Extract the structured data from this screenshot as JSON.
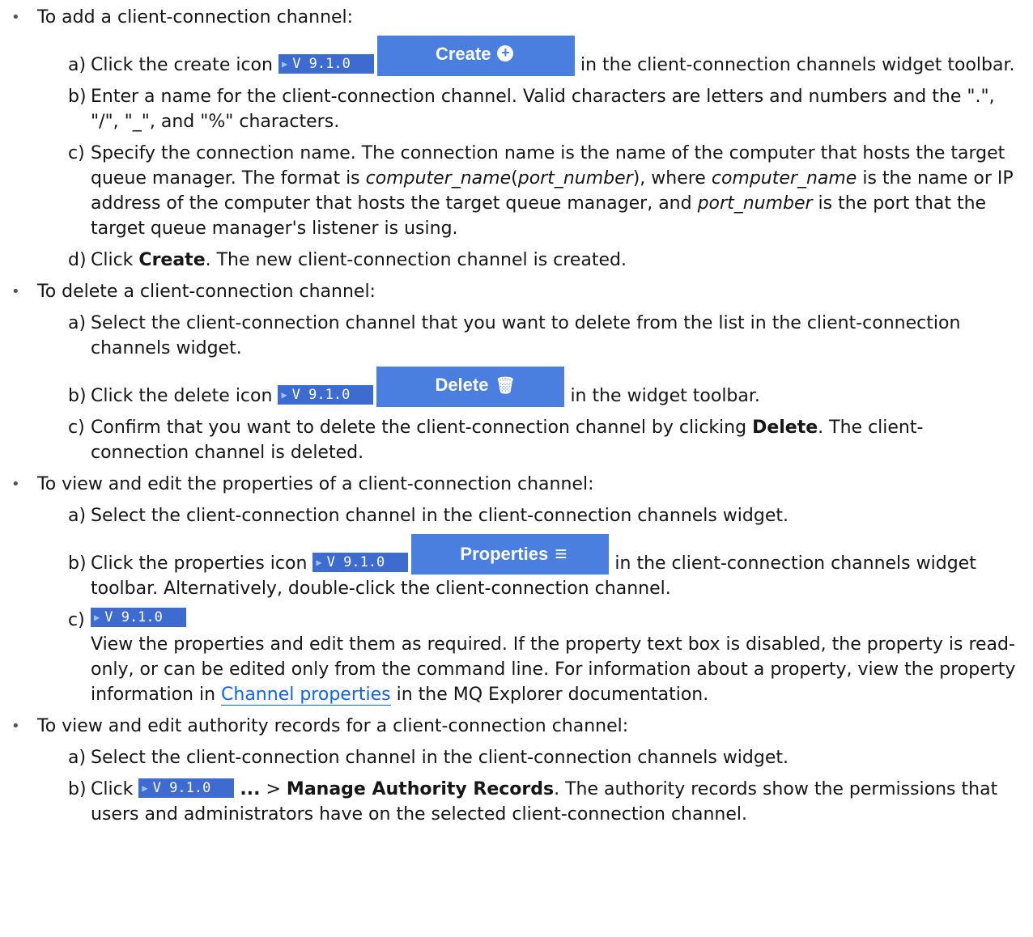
{
  "badge_text": "V 9.1.0",
  "buttons": {
    "create": "Create",
    "delete": "Delete",
    "properties": "Properties"
  },
  "sections": {
    "add": {
      "title": "To add a client-connection channel:",
      "a_label": "a)",
      "a_before": "Click the create icon",
      "a_after": "in the client-connection channels widget toolbar.",
      "b_label": "b)",
      "b_text": "Enter a name for the client-connection channel. Valid characters are letters and numbers and the \".\", \"/\", \"_\", and \"%\" characters.",
      "c_label": "c)",
      "c_1": "Specify the connection name. The connection name is the name of the computer that hosts the target queue manager. The format is ",
      "c_i1": "computer_name",
      "c_2": "(",
      "c_i2": "port_number",
      "c_3": "), where ",
      "c_i3": "computer_name",
      "c_4": " is the name or IP address of the computer that hosts the target queue manager, and ",
      "c_i4": "port_number",
      "c_5": " is the port that the target queue manager's listener is using.",
      "d_label": "d)",
      "d_before": "Click ",
      "d_bold": "Create",
      "d_after": ". The new client-connection channel is created."
    },
    "delete": {
      "title": "To delete a client-connection channel:",
      "a_label": "a)",
      "a_text": "Select the client-connection channel that you want to delete from the list in the client-connection channels widget.",
      "b_label": "b)",
      "b_before": "Click the delete icon",
      "b_after": "in the widget toolbar.",
      "c_label": "c)",
      "c_before": "Confirm that you want to delete the client-connection channel by clicking ",
      "c_bold": "Delete",
      "c_after": ". The client-connection channel is deleted."
    },
    "properties": {
      "title": "To view and edit the properties of a client-connection channel:",
      "a_label": "a)",
      "a_text": "Select the client-connection channel in the client-connection channels widget.",
      "b_label": "b)",
      "b_before": "Click the properties icon",
      "b_after": "in the client-connection channels widget toolbar. Alternatively, double-click the client-connection channel.",
      "c_label": "c)",
      "c_text": "View the properties and edit them as required. If the property text box is disabled, the property is read-only, or can be edited only from the command line. For information about a property, view the property information in ",
      "c_link": "Channel properties",
      "c_after": " in the MQ Explorer documentation."
    },
    "authority": {
      "title": "To view and edit authority records for a client-connection channel:",
      "a_label": "a)",
      "a_text": "Select the client-connection channel in the client-connection channels widget.",
      "b_label": "b)",
      "b_before": "Click ",
      "b_ellipsis": "...",
      "b_sep": " > ",
      "b_bold": "Manage Authority Records",
      "b_after": ". The authority records show the permissions that users and administrators have on the selected client-connection channel."
    }
  }
}
